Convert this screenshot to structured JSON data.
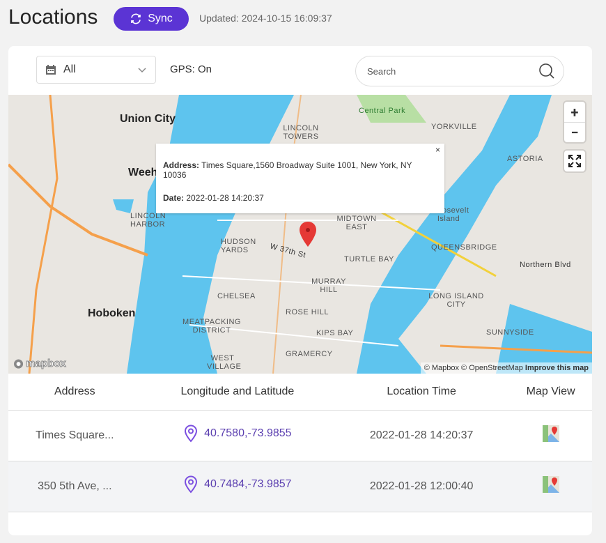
{
  "header": {
    "title": "Locations",
    "sync_label": "Sync",
    "updated": "Updated: 2024-10-15 16:09:37"
  },
  "toolbar": {
    "filter_value": "All",
    "gps_status": "GPS: On",
    "search_placeholder": "Search"
  },
  "map": {
    "labels": [
      "Union City",
      "Hoboken",
      "Weeh",
      "LINCOLN HARBOR",
      "HUDSON YARDS",
      "CHELSEA",
      "MEATPACKING DISTRICT",
      "WEST VILLAGE",
      "GRAMERCY",
      "ROSE HILL",
      "MURRAY HILL",
      "KIPS BAY",
      "TURTLE BAY",
      "MIDTOWN EAST",
      "W 37th St",
      "Central Park",
      "YORKVILLE",
      "LINCOLN TOWERS",
      "ASTORIA",
      "QUEENSBRIDGE",
      "LONG ISLAND CITY",
      "SUNNYSIDE",
      "Northern Blvd",
      "Roosevelt Island"
    ],
    "zoom_in": "+",
    "zoom_out": "−",
    "popup": {
      "address_label": "Address:",
      "address": "Times Square,1560 Broadway Suite 1001, New York, NY 10036",
      "date_label": "Date:",
      "date": "2022-01-28 14:20:37",
      "close": "×"
    },
    "logo": "mapbox",
    "attribution": "© Mapbox © OpenStreetMap",
    "improve": "Improve this map",
    "colors": {
      "land": "#e9e6e1",
      "water": "#5ec4ee",
      "park": "#b8dfa4",
      "highway": "#f5a04b",
      "marker": "#e53935"
    }
  },
  "table": {
    "headers": [
      "Address",
      "Longitude and Latitude",
      "Location Time",
      "Map View"
    ],
    "rows": [
      {
        "address": "Times Square...",
        "coords": "40.7580,-73.9855",
        "time": "2022-01-28 14:20:37",
        "map_icon": "google-maps-icon"
      },
      {
        "address": "350 5th Ave, ...",
        "coords": "40.7484,-73.9857",
        "time": "2022-01-28 12:00:40",
        "map_icon": "google-maps-icon"
      }
    ]
  },
  "colors": {
    "accent": "#5b34d4",
    "link": "#5b3fb0"
  }
}
